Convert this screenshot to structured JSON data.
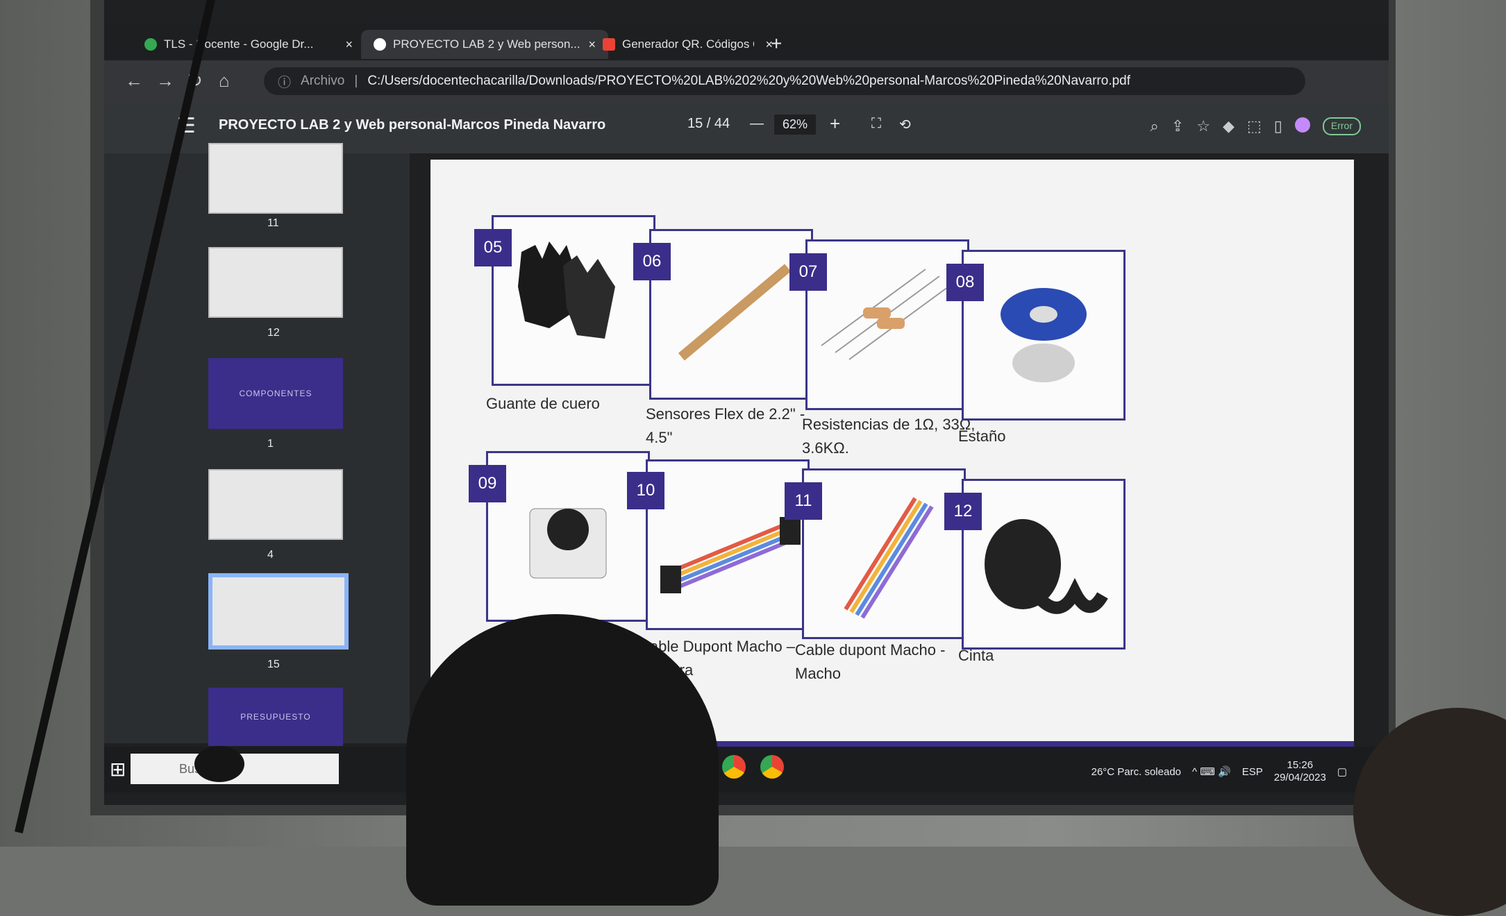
{
  "browser": {
    "tabs": [
      {
        "label": "TLS - Docente - Google Dr...",
        "close": "×",
        "fav_color": "#34a853"
      },
      {
        "label": "PROYECTO LAB 2 y Web person...",
        "close": "×",
        "fav_color": "#ffffff"
      },
      {
        "label": "Generador QR. Códigos QR Gra...",
        "close": "×",
        "fav_color": "#ea4335"
      }
    ],
    "new_tab": "+",
    "nav": {
      "back": "←",
      "forward": "→",
      "reload": "↻",
      "home": "⌂"
    },
    "address": {
      "scheme": "Archivo",
      "url": "C:/Users/docentechacarilla/Downloads/PROYECTO%20LAB%202%20y%20Web%20personal-Marcos%20Pineda%20Navarro.pdf"
    }
  },
  "pdf_viewer": {
    "menu_icon": "☰",
    "title": "PROYECTO LAB 2 y Web personal-Marcos Pineda Navarro",
    "page_indicator": "15 / 44",
    "zoom_out": "—",
    "zoom": "62%",
    "zoom_in": "+",
    "error_label": "Error"
  },
  "sidebar": {
    "thumbnails": [
      {
        "num": "11",
        "text": ""
      },
      {
        "num": "12",
        "text": ""
      },
      {
        "num": "1",
        "text": "COMPONENTES"
      },
      {
        "num": "4",
        "text": ""
      },
      {
        "num": "15",
        "text": ""
      },
      {
        "num": "",
        "text": "PRESUPUESTO"
      }
    ]
  },
  "components": [
    {
      "id": "05",
      "label": "Guante de cuero",
      "icon": "glove-icon"
    },
    {
      "id": "06",
      "label": "Sensores Flex de 2.2\" - 4.5\"",
      "icon": "flex-sensor-icon"
    },
    {
      "id": "07",
      "label": "Resistencias de 1Ω, 33Ω, 3.6KΩ.",
      "icon": "resistor-icon"
    },
    {
      "id": "08",
      "label": "Estaño",
      "icon": "solder-spool-icon"
    },
    {
      "id": "09",
      "label": "",
      "icon": "push-button-icon"
    },
    {
      "id": "10",
      "label": "Cable Dupont Macho – Hembra",
      "icon": "dupont-cable-icon"
    },
    {
      "id": "11",
      "label": "Cable dupont Macho - Macho",
      "icon": "dupont-cable-icon"
    },
    {
      "id": "12",
      "label": "Cinta",
      "icon": "tape-icon"
    }
  ],
  "taskbar": {
    "search_placeholder": "Buscar",
    "weather": "26°C Parc. soleado",
    "lang": "ESP",
    "time": "15:26",
    "date": "29/04/2023"
  },
  "colors": {
    "accent": "#3a2e8a",
    "chrome_dark": "#35363a"
  }
}
